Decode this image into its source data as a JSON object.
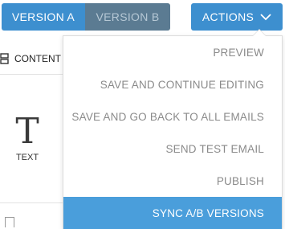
{
  "topbar": {
    "version_a_label": "VERSION A",
    "version_b_label": "VERSION B",
    "actions_label": "ACTIONS"
  },
  "sidebar": {
    "content_tab_label": "CONTENT",
    "text_block_glyph": "T",
    "text_block_label": "TEXT"
  },
  "dropdown": {
    "items": [
      {
        "label": "PREVIEW"
      },
      {
        "label": "SAVE AND CONTINUE EDITING"
      },
      {
        "label": "SAVE AND GO BACK TO ALL EMAILS"
      },
      {
        "label": "SEND TEST EMAIL"
      },
      {
        "label": "PUBLISH"
      },
      {
        "label": "SYNC A/B VERSIONS",
        "highlighted": true
      }
    ]
  },
  "colors": {
    "accent": "#3d8fcf",
    "inactive_tab": "#5b7b92",
    "highlight": "#4a9edb"
  }
}
